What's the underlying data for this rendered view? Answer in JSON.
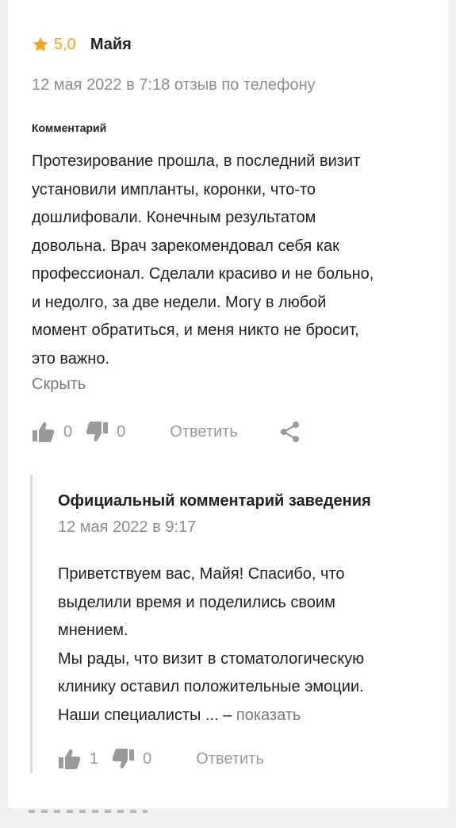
{
  "review": {
    "rating": "5,0",
    "author": "Майя",
    "meta": "12 мая 2022 в 7:18 отзыв по телефону",
    "comment_label": "Комментарий",
    "text": "Протезирование прошла, в последний визит\nустановили импланты, коронки, что-то\nдошлифовали. Конечным результатом\nдовольна. Врач зарекомендовал себя как\nпрофессионал. Сделали красиво и не больно,\nи недолго, за две недели. Могу в любой\nмомент обратиться, и меня никто не бросит,\nэто важно.",
    "hide_label": "Скрыть",
    "likes": "0",
    "dislikes": "0",
    "reply_label": "Ответить",
    "star_color": "#f4a51c"
  },
  "official": {
    "title": "Официальный комментарий заведения",
    "date": "12 мая 2022 в 9:17",
    "paragraph1": "Приветствуем вас, Майя! Спасибо, что\nвыделили время и поделились своим\nмнением.",
    "paragraph2_prefix": "Мы рады, что визит в стоматологическую\nклинику оставил положительные эмоции.\nНаши специалисты ... – ",
    "show_more": "показать",
    "likes": "1",
    "dislikes": "0",
    "reply_label": "Ответить"
  },
  "icons": {
    "star": "star-icon",
    "like": "thumbs-up-icon",
    "dislike": "thumbs-down-icon",
    "share": "share-icon"
  }
}
